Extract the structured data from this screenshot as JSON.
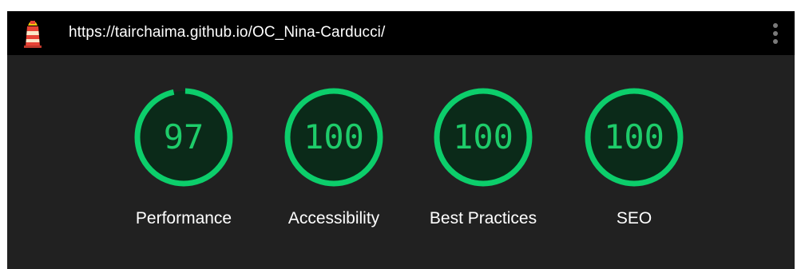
{
  "header": {
    "url": "https://tairchaima.github.io/OC_Nina-Carducci/"
  },
  "colors": {
    "pass": "#0cce6b",
    "pass_text": "#1ecc6a",
    "pass_fill": "#0b2a19"
  },
  "gauges": [
    {
      "score": "97",
      "value": 0.97,
      "label": "Performance"
    },
    {
      "score": "100",
      "value": 1.0,
      "label": "Accessibility"
    },
    {
      "score": "100",
      "value": 1.0,
      "label": "Best Practices"
    },
    {
      "score": "100",
      "value": 1.0,
      "label": "SEO"
    }
  ]
}
